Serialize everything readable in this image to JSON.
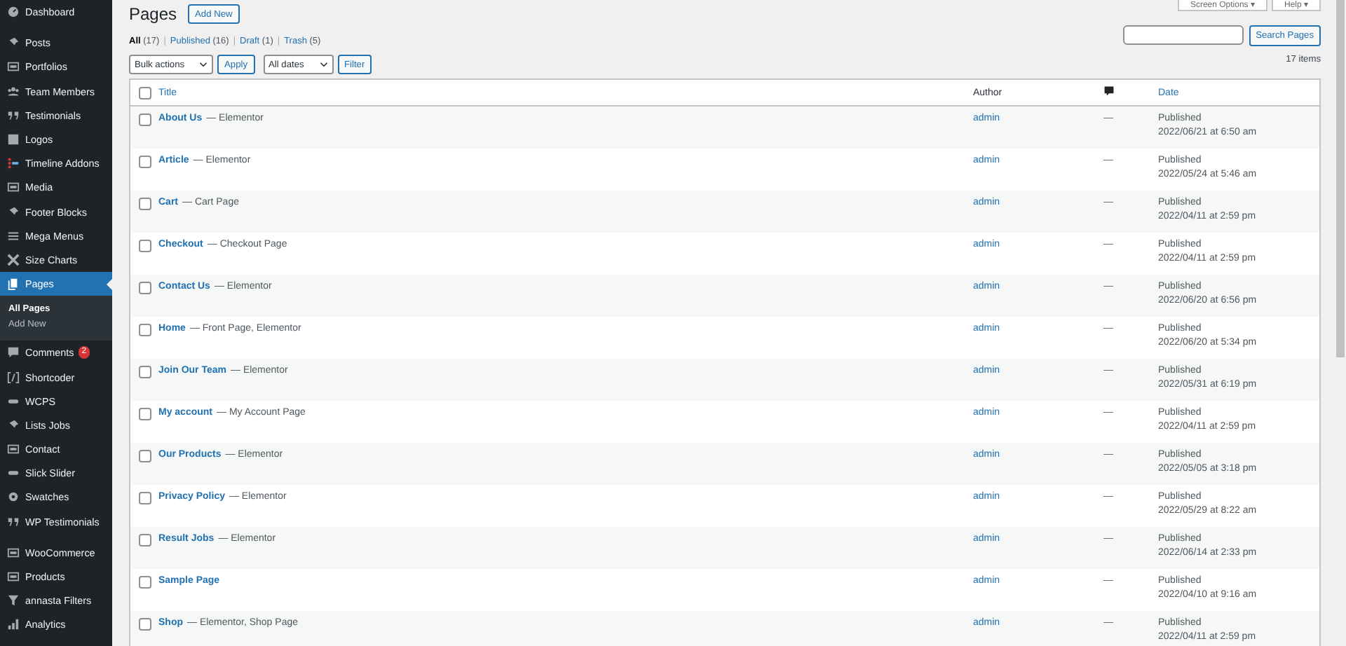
{
  "sidebar": {
    "groups": [
      [
        {
          "label": "Dashboard",
          "selected": false
        }
      ],
      [
        {
          "label": "Posts",
          "selected": false
        },
        {
          "label": "Portfolios",
          "selected": false
        },
        {
          "label": "Team Members",
          "selected": false
        },
        {
          "label": "Testimonials",
          "selected": false
        },
        {
          "label": "Logos",
          "selected": false
        },
        {
          "label": "Timeline Addons",
          "selected": false
        },
        {
          "label": "Media",
          "selected": false
        },
        {
          "label": "Footer Blocks",
          "selected": false
        },
        {
          "label": "Mega Menus",
          "selected": false
        },
        {
          "label": "Size Charts",
          "selected": false
        },
        {
          "label": "Pages",
          "selected": true,
          "children": [
            {
              "label": "All Pages",
              "selected": true
            },
            {
              "label": "Add New",
              "selected": false
            }
          ]
        },
        {
          "label": "Comments",
          "selected": false,
          "badge": "2"
        },
        {
          "label": "Shortcoder",
          "selected": false
        },
        {
          "label": "WCPS",
          "selected": false
        },
        {
          "label": "Lists Jobs",
          "selected": false
        },
        {
          "label": "Contact",
          "selected": false
        },
        {
          "label": "Slick Slider",
          "selected": false
        },
        {
          "label": "Swatches",
          "selected": false
        },
        {
          "label": "WP Testimonials",
          "selected": false
        }
      ],
      [
        {
          "label": "WooCommerce",
          "selected": false
        },
        {
          "label": "Products",
          "selected": false
        },
        {
          "label": "annasta Filters",
          "selected": false
        },
        {
          "label": "Analytics",
          "selected": false
        }
      ]
    ]
  },
  "screen_meta": [
    "Screen Options ▾",
    "Help ▾"
  ],
  "heading": {
    "title": "Pages",
    "add_button": "Add New"
  },
  "views": {
    "separator": "|",
    "items": [
      {
        "label": "All",
        "count": "(17)",
        "selected": true
      },
      {
        "label": "Published",
        "count": "(16)",
        "selected": false
      },
      {
        "label": "Draft",
        "count": "(1)",
        "selected": false
      },
      {
        "label": "Trash",
        "count": "(5)",
        "selected": false
      }
    ]
  },
  "search": {
    "button": "Search Pages"
  },
  "tablenav": {
    "bulk_select": "Bulk actions",
    "apply": "Apply",
    "date_select": "All dates",
    "filter": "Filter",
    "count": "17 items"
  },
  "table": {
    "select_all_checked": false,
    "columns": {
      "title": "Title",
      "author": "Author",
      "date": "Date"
    },
    "rows": [
      {
        "checked": false,
        "title": "About Us",
        "state": "— Elementor",
        "author": "admin",
        "comments": "—",
        "status": "Published",
        "date": "2022/06/21 at 6:50 am"
      },
      {
        "checked": false,
        "title": "Article",
        "state": "— Elementor",
        "author": "admin",
        "comments": "—",
        "status": "Published",
        "date": "2022/05/24 at 5:46 am"
      },
      {
        "checked": false,
        "title": "Cart",
        "state": "— Cart Page",
        "author": "admin",
        "comments": "—",
        "status": "Published",
        "date": "2022/04/11 at 2:59 pm"
      },
      {
        "checked": false,
        "title": "Checkout",
        "state": "— Checkout Page",
        "author": "admin",
        "comments": "—",
        "status": "Published",
        "date": "2022/04/11 at 2:59 pm"
      },
      {
        "checked": false,
        "title": "Contact Us",
        "state": "— Elementor",
        "author": "admin",
        "comments": "—",
        "status": "Published",
        "date": "2022/06/20 at 6:56 pm"
      },
      {
        "checked": false,
        "title": "Home",
        "state": "— Front Page, Elementor",
        "author": "admin",
        "comments": "—",
        "status": "Published",
        "date": "2022/06/20 at 5:34 pm"
      },
      {
        "checked": false,
        "title": "Join Our Team",
        "state": "— Elementor",
        "author": "admin",
        "comments": "—",
        "status": "Published",
        "date": "2022/05/31 at 6:19 pm"
      },
      {
        "checked": false,
        "title": "My account",
        "state": "— My Account Page",
        "author": "admin",
        "comments": "—",
        "status": "Published",
        "date": "2022/04/11 at 2:59 pm"
      },
      {
        "checked": false,
        "title": "Our Products",
        "state": "— Elementor",
        "author": "admin",
        "comments": "—",
        "status": "Published",
        "date": "2022/05/05 at 3:18 pm"
      },
      {
        "checked": false,
        "title": "Privacy Policy",
        "state": "— Elementor",
        "author": "admin",
        "comments": "—",
        "status": "Published",
        "date": "2022/05/29 at 8:22 am"
      },
      {
        "checked": false,
        "title": "Result Jobs",
        "state": "— Elementor",
        "author": "admin",
        "comments": "—",
        "status": "Published",
        "date": "2022/06/14 at 2:33 pm"
      },
      {
        "checked": false,
        "title": "Sample Page",
        "author": "admin",
        "comments": "—",
        "status": "Published",
        "date": "2022/04/10 at 9:16 am"
      },
      {
        "checked": false,
        "title": "Shop",
        "state": "— Elementor, Shop Page",
        "author": "admin",
        "comments": "—",
        "status": "Published",
        "date": "2022/04/11 at 2:59 pm"
      }
    ]
  }
}
